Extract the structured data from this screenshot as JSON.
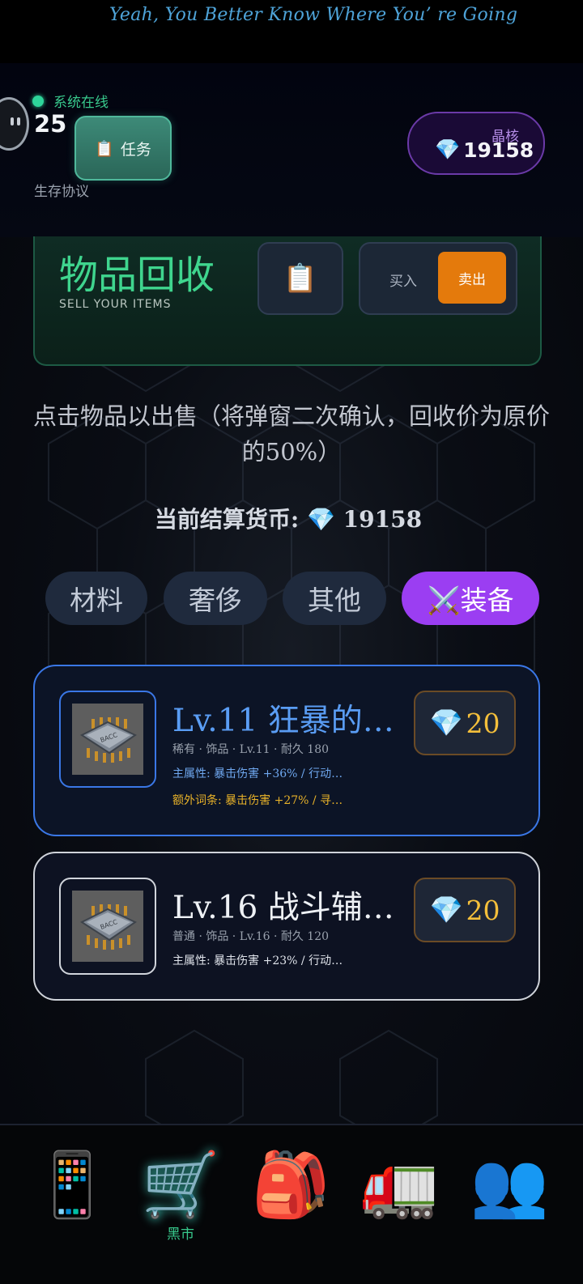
{
  "banner": {
    "slogan": "Yeah, You Better Know Where You’ re Going"
  },
  "status": {
    "online_text": "系统在线",
    "level": "25",
    "survival_label": "生存协议"
  },
  "task_button": {
    "icon": "📋",
    "label": "任务"
  },
  "crystal": {
    "label": "晶核",
    "icon": "💎",
    "value": "19158"
  },
  "recycle": {
    "title": "物品回收",
    "subtitle": "SELL YOUR ITEMS",
    "clipboard_icon": "📋",
    "buy_label": "买入",
    "sell_label": "卖出"
  },
  "hint": "点击物品以出售（将弹窗二次确认，回收价为原价的50%）",
  "currency": {
    "label": "当前结算货币:",
    "icon": "💎",
    "value": "19158"
  },
  "tabs": [
    {
      "label": "材料",
      "active": false
    },
    {
      "label": "奢侈",
      "active": false
    },
    {
      "label": "其他",
      "active": false
    },
    {
      "label": "⚔️装备",
      "active": true
    }
  ],
  "items": [
    {
      "name": "Lv.11 狂暴的…",
      "meta": "稀有 · 饰品 · Lv.11 · 耐久 180",
      "main_attr": "主属性: 暴击伤害 +36% / 行动…",
      "extra_attr": "额外词条: 暴击伤害 +27% / 寻…",
      "price_icon": "💎",
      "price": "20",
      "chip_text": "BACC",
      "rarity_color": "#3a77e6"
    },
    {
      "name": "Lv.16 战斗辅…",
      "meta": "普通 · 饰品 · Lv.16 · 耐久 120",
      "main_attr": "主属性: 暴击伤害 +23% / 行动…",
      "price_icon": "💎",
      "price": "20",
      "chip_text": "BACC",
      "rarity_color": "#cfd3da"
    }
  ],
  "nav": [
    {
      "icon": "📱",
      "label": ""
    },
    {
      "icon": "🛒",
      "label": "黑市",
      "active": true
    },
    {
      "icon": "🎒",
      "label": ""
    },
    {
      "icon": "🚛",
      "label": ""
    },
    {
      "icon": "👥",
      "label": ""
    }
  ]
}
